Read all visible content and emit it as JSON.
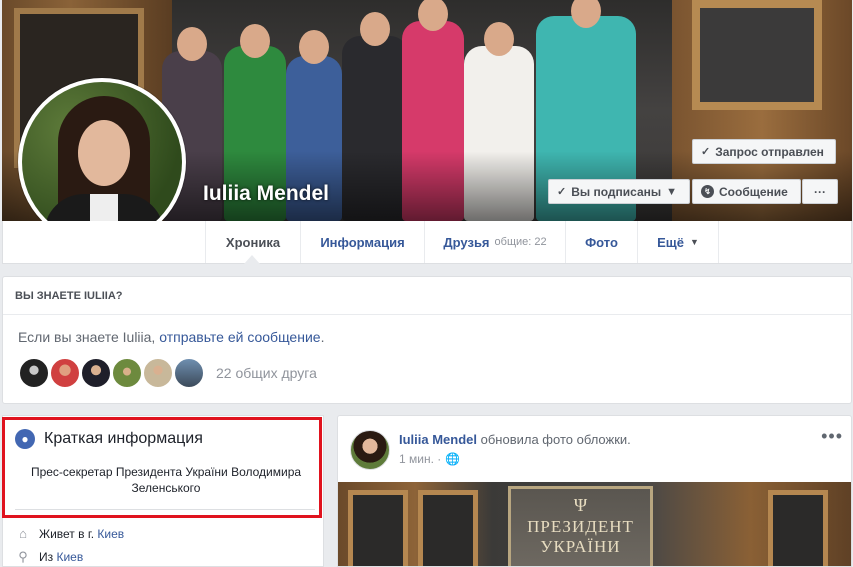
{
  "profile": {
    "name": "Iuliia Mendel"
  },
  "actions": {
    "request_sent": "Запрос отправлен",
    "following": "Вы подписаны",
    "message": "Сообщение",
    "more": "···"
  },
  "nav": {
    "tabs": [
      {
        "label": "Хроника",
        "active": true
      },
      {
        "label": "Информация"
      },
      {
        "label": "Друзья",
        "sub": "общие: 22"
      },
      {
        "label": "Фото"
      },
      {
        "label": "Ещё"
      }
    ]
  },
  "know_card": {
    "heading": "ВЫ ЗНАЕТЕ IULIIA?",
    "text_prefix": "Если вы знаете Iuliia, ",
    "text_link": "отправьте ей сообщение",
    "text_suffix": ".",
    "mutual_friends": "22 общих друга"
  },
  "intro": {
    "title": "Краткая информация",
    "bio": "Прес-секретар Президента України Володимира Зеленського",
    "lives_prefix": "Живет в г. ",
    "lives_city": "Киев",
    "from_prefix": "Из ",
    "from_city": "Киев"
  },
  "post": {
    "author": "Iuliia Mendel",
    "action": " обновила фото обложки.",
    "time": "1 мин. ·",
    "dots": "•••",
    "plaque_line1": "ПРЕЗИДЕНТ",
    "plaque_line2": "УКРАЇНИ"
  },
  "colors": {
    "link": "#365899",
    "highlight": "#e0131e",
    "background": "#e9ebee"
  }
}
